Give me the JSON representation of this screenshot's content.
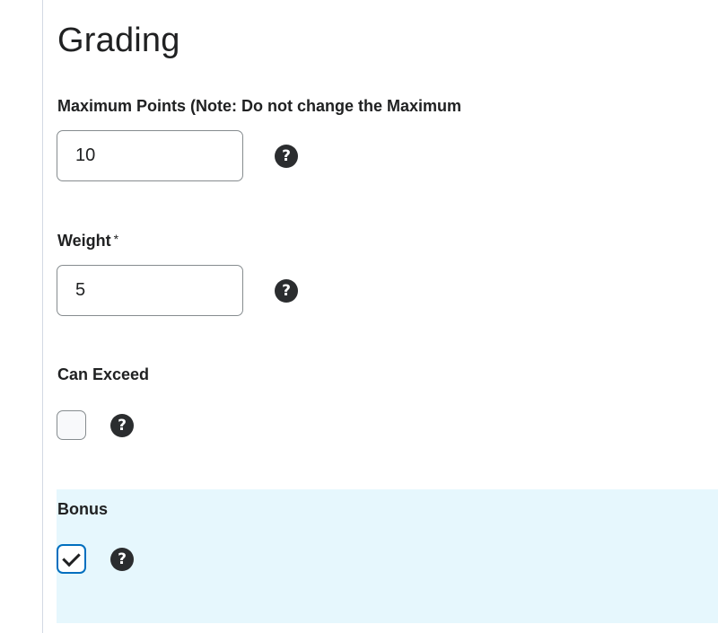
{
  "section": {
    "title": "Grading"
  },
  "max_points": {
    "label": "Maximum Points (Note: Do not change the Maximum",
    "value": "10",
    "help_icon": "question-circle-icon"
  },
  "weight": {
    "label": "Weight",
    "required_marker": "*",
    "value": "5",
    "help_icon": "question-circle-icon"
  },
  "can_exceed": {
    "label": "Can Exceed",
    "checked": false,
    "help_icon": "question-circle-icon"
  },
  "bonus": {
    "label": "Bonus",
    "checked": true,
    "help_icon": "question-circle-icon",
    "highlight_color": "#e6f7fd"
  },
  "colors": {
    "focus_border": "#006fbf",
    "text": "#202122",
    "input_border": "#868c8f"
  }
}
